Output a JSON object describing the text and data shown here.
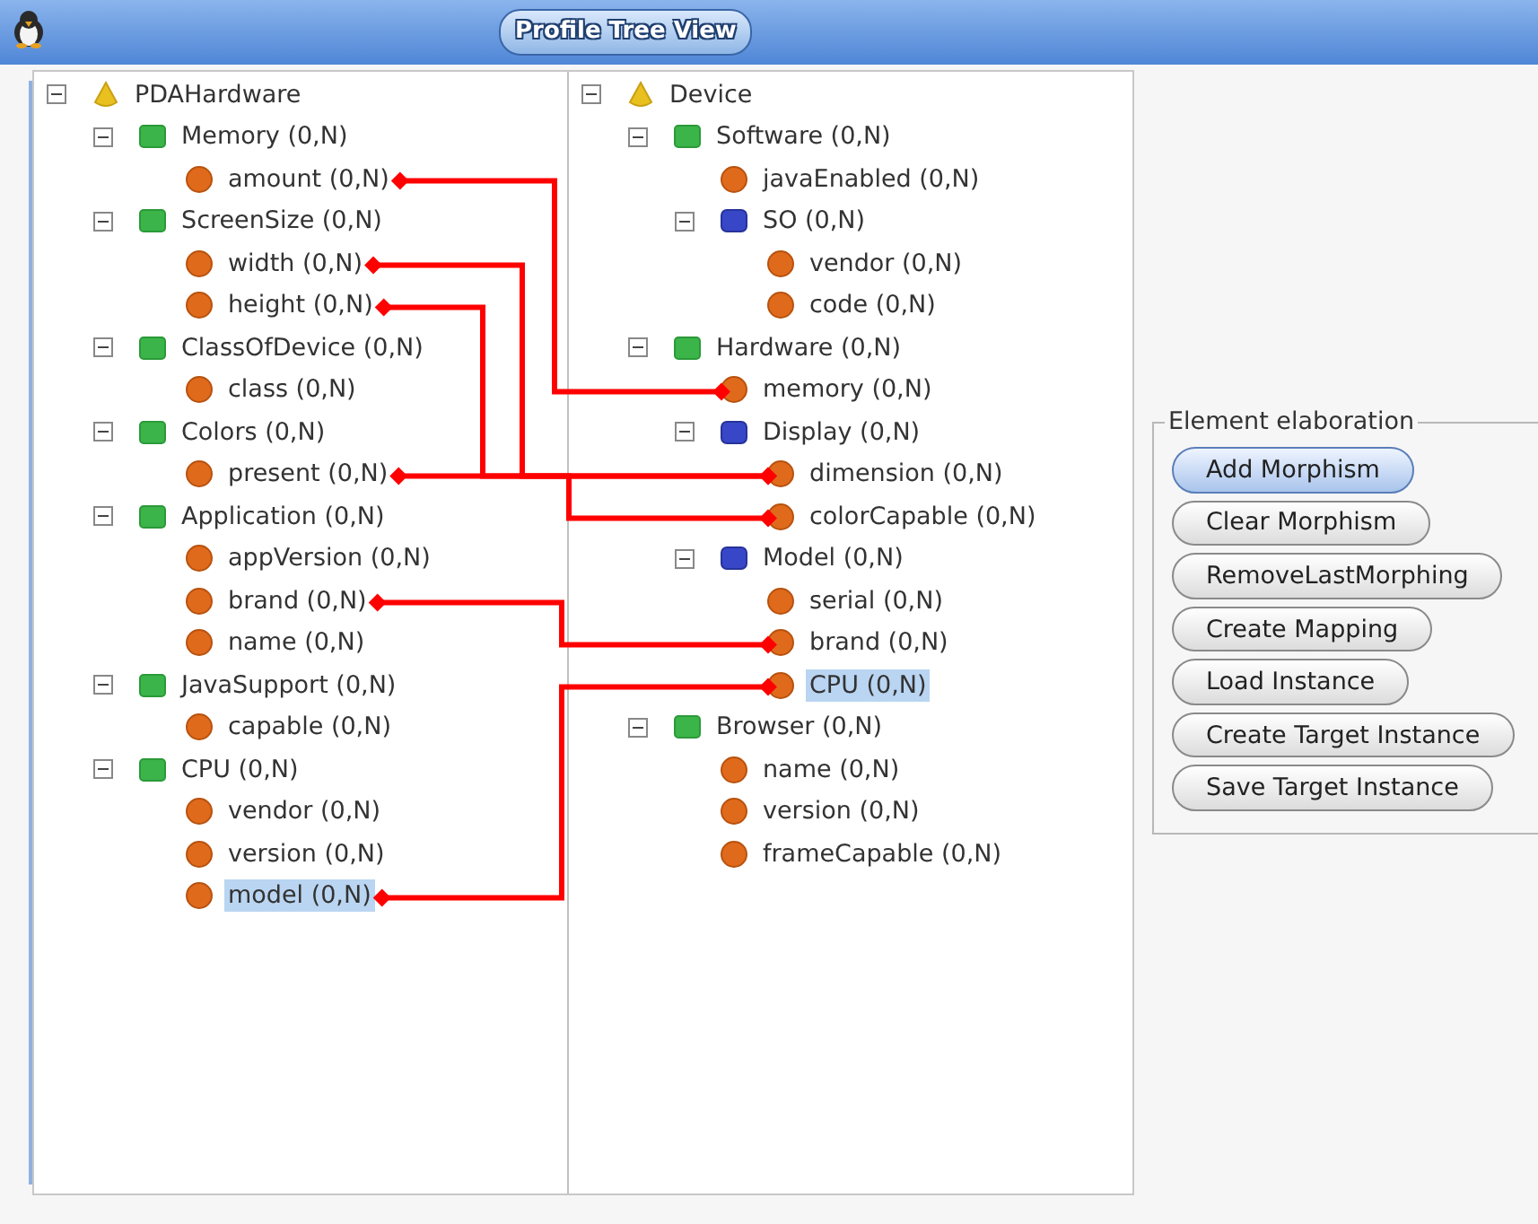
{
  "window": {
    "title": "Profile Tree View"
  },
  "trees": [
    {
      "nodes": [
        {
          "label": "PDAHardware",
          "kind": "root",
          "expanded": true,
          "selected": false,
          "children": [
            {
              "label": "Memory (0,N)",
              "kind": "element",
              "expanded": true,
              "selected": false,
              "children": [
                {
                  "label": "amount (0,N)",
                  "kind": "attribute",
                  "selected": false,
                  "mapped": true
                }
              ]
            },
            {
              "label": "ScreenSize (0,N)",
              "kind": "element",
              "expanded": true,
              "selected": false,
              "children": [
                {
                  "label": "width (0,N)",
                  "kind": "attribute",
                  "selected": false,
                  "mapped": true
                },
                {
                  "label": "height (0,N)",
                  "kind": "attribute",
                  "selected": false,
                  "mapped": true,
                  "joins_previous": true
                }
              ]
            },
            {
              "label": "ClassOfDevice (0,N)",
              "kind": "element",
              "expanded": true,
              "selected": false,
              "children": [
                {
                  "label": "class (0,N)",
                  "kind": "attribute",
                  "selected": false
                }
              ]
            },
            {
              "label": "Colors (0,N)",
              "kind": "element",
              "expanded": true,
              "selected": false,
              "children": [
                {
                  "label": "present (0,N)",
                  "kind": "attribute",
                  "selected": false,
                  "mapped": true
                }
              ]
            },
            {
              "label": "Application (0,N)",
              "kind": "element",
              "expanded": true,
              "selected": false,
              "children": [
                {
                  "label": "appVersion (0,N)",
                  "kind": "attribute",
                  "selected": false
                },
                {
                  "label": "brand (0,N)",
                  "kind": "attribute",
                  "selected": false,
                  "mapped": true
                },
                {
                  "label": "name (0,N)",
                  "kind": "attribute",
                  "selected": false
                }
              ]
            },
            {
              "label": "JavaSupport (0,N)",
              "kind": "element",
              "expanded": true,
              "selected": false,
              "children": [
                {
                  "label": "capable (0,N)",
                  "kind": "attribute",
                  "selected": false
                }
              ]
            },
            {
              "label": "CPU (0,N)",
              "kind": "element",
              "expanded": true,
              "selected": false,
              "children": [
                {
                  "label": "vendor (0,N)",
                  "kind": "attribute",
                  "selected": false
                },
                {
                  "label": "version (0,N)",
                  "kind": "attribute",
                  "selected": false
                },
                {
                  "label": "model (0,N)",
                  "kind": "attribute",
                  "selected": true,
                  "mapped": true
                }
              ]
            }
          ]
        }
      ]
    },
    {
      "nodes": [
        {
          "label": "Device",
          "kind": "root",
          "expanded": true,
          "selected": false,
          "children": [
            {
              "label": "Software (0,N)",
              "kind": "element",
              "expanded": true,
              "selected": false,
              "children": [
                {
                  "label": "javaEnabled (0,N)",
                  "kind": "attribute",
                  "selected": false
                },
                {
                  "label": "SO (0,N)",
                  "kind": "complex",
                  "expanded": true,
                  "selected": false,
                  "children": [
                    {
                      "label": "vendor (0,N)",
                      "kind": "attribute",
                      "selected": false
                    },
                    {
                      "label": "code (0,N)",
                      "kind": "attribute",
                      "selected": false
                    }
                  ]
                }
              ]
            },
            {
              "label": "Hardware (0,N)",
              "kind": "element",
              "expanded": true,
              "selected": false,
              "children": [
                {
                  "label": "memory (0,N)",
                  "kind": "attribute",
                  "selected": false,
                  "mapped": true
                },
                {
                  "label": "Display (0,N)",
                  "kind": "complex",
                  "expanded": true,
                  "selected": false,
                  "children": [
                    {
                      "label": "dimension (0,N)",
                      "kind": "attribute",
                      "selected": false,
                      "mapped": true
                    },
                    {
                      "label": "colorCapable (0,N)",
                      "kind": "attribute",
                      "selected": false,
                      "mapped": true
                    }
                  ]
                },
                {
                  "label": "Model (0,N)",
                  "kind": "complex",
                  "expanded": true,
                  "selected": false,
                  "children": [
                    {
                      "label": "serial (0,N)",
                      "kind": "attribute",
                      "selected": false
                    },
                    {
                      "label": "brand (0,N)",
                      "kind": "attribute",
                      "selected": false,
                      "mapped": true
                    },
                    {
                      "label": "CPU (0,N)",
                      "kind": "attribute",
                      "selected": true,
                      "mapped": true
                    }
                  ]
                }
              ]
            },
            {
              "label": "Browser (0,N)",
              "kind": "element",
              "expanded": true,
              "selected": false,
              "children": [
                {
                  "label": "name (0,N)",
                  "kind": "attribute",
                  "selected": false
                },
                {
                  "label": "version (0,N)",
                  "kind": "attribute",
                  "selected": false
                },
                {
                  "label": "frameCapable (0,N)",
                  "kind": "attribute",
                  "selected": false
                }
              ]
            }
          ]
        }
      ]
    }
  ],
  "element_elaboration": {
    "title": "Element elaboration",
    "buttons": [
      {
        "label": "Add Morphism",
        "focused": true
      },
      {
        "label": "Clear Morphism",
        "focused": false
      },
      {
        "label": "RemoveLastMorphing",
        "focused": false
      },
      {
        "label": "Create Mapping",
        "focused": false
      },
      {
        "label": "Load Instance",
        "focused": false
      },
      {
        "label": "Create Target Instance",
        "focused": false
      },
      {
        "label": "Save Target Instance",
        "focused": false
      }
    ]
  }
}
